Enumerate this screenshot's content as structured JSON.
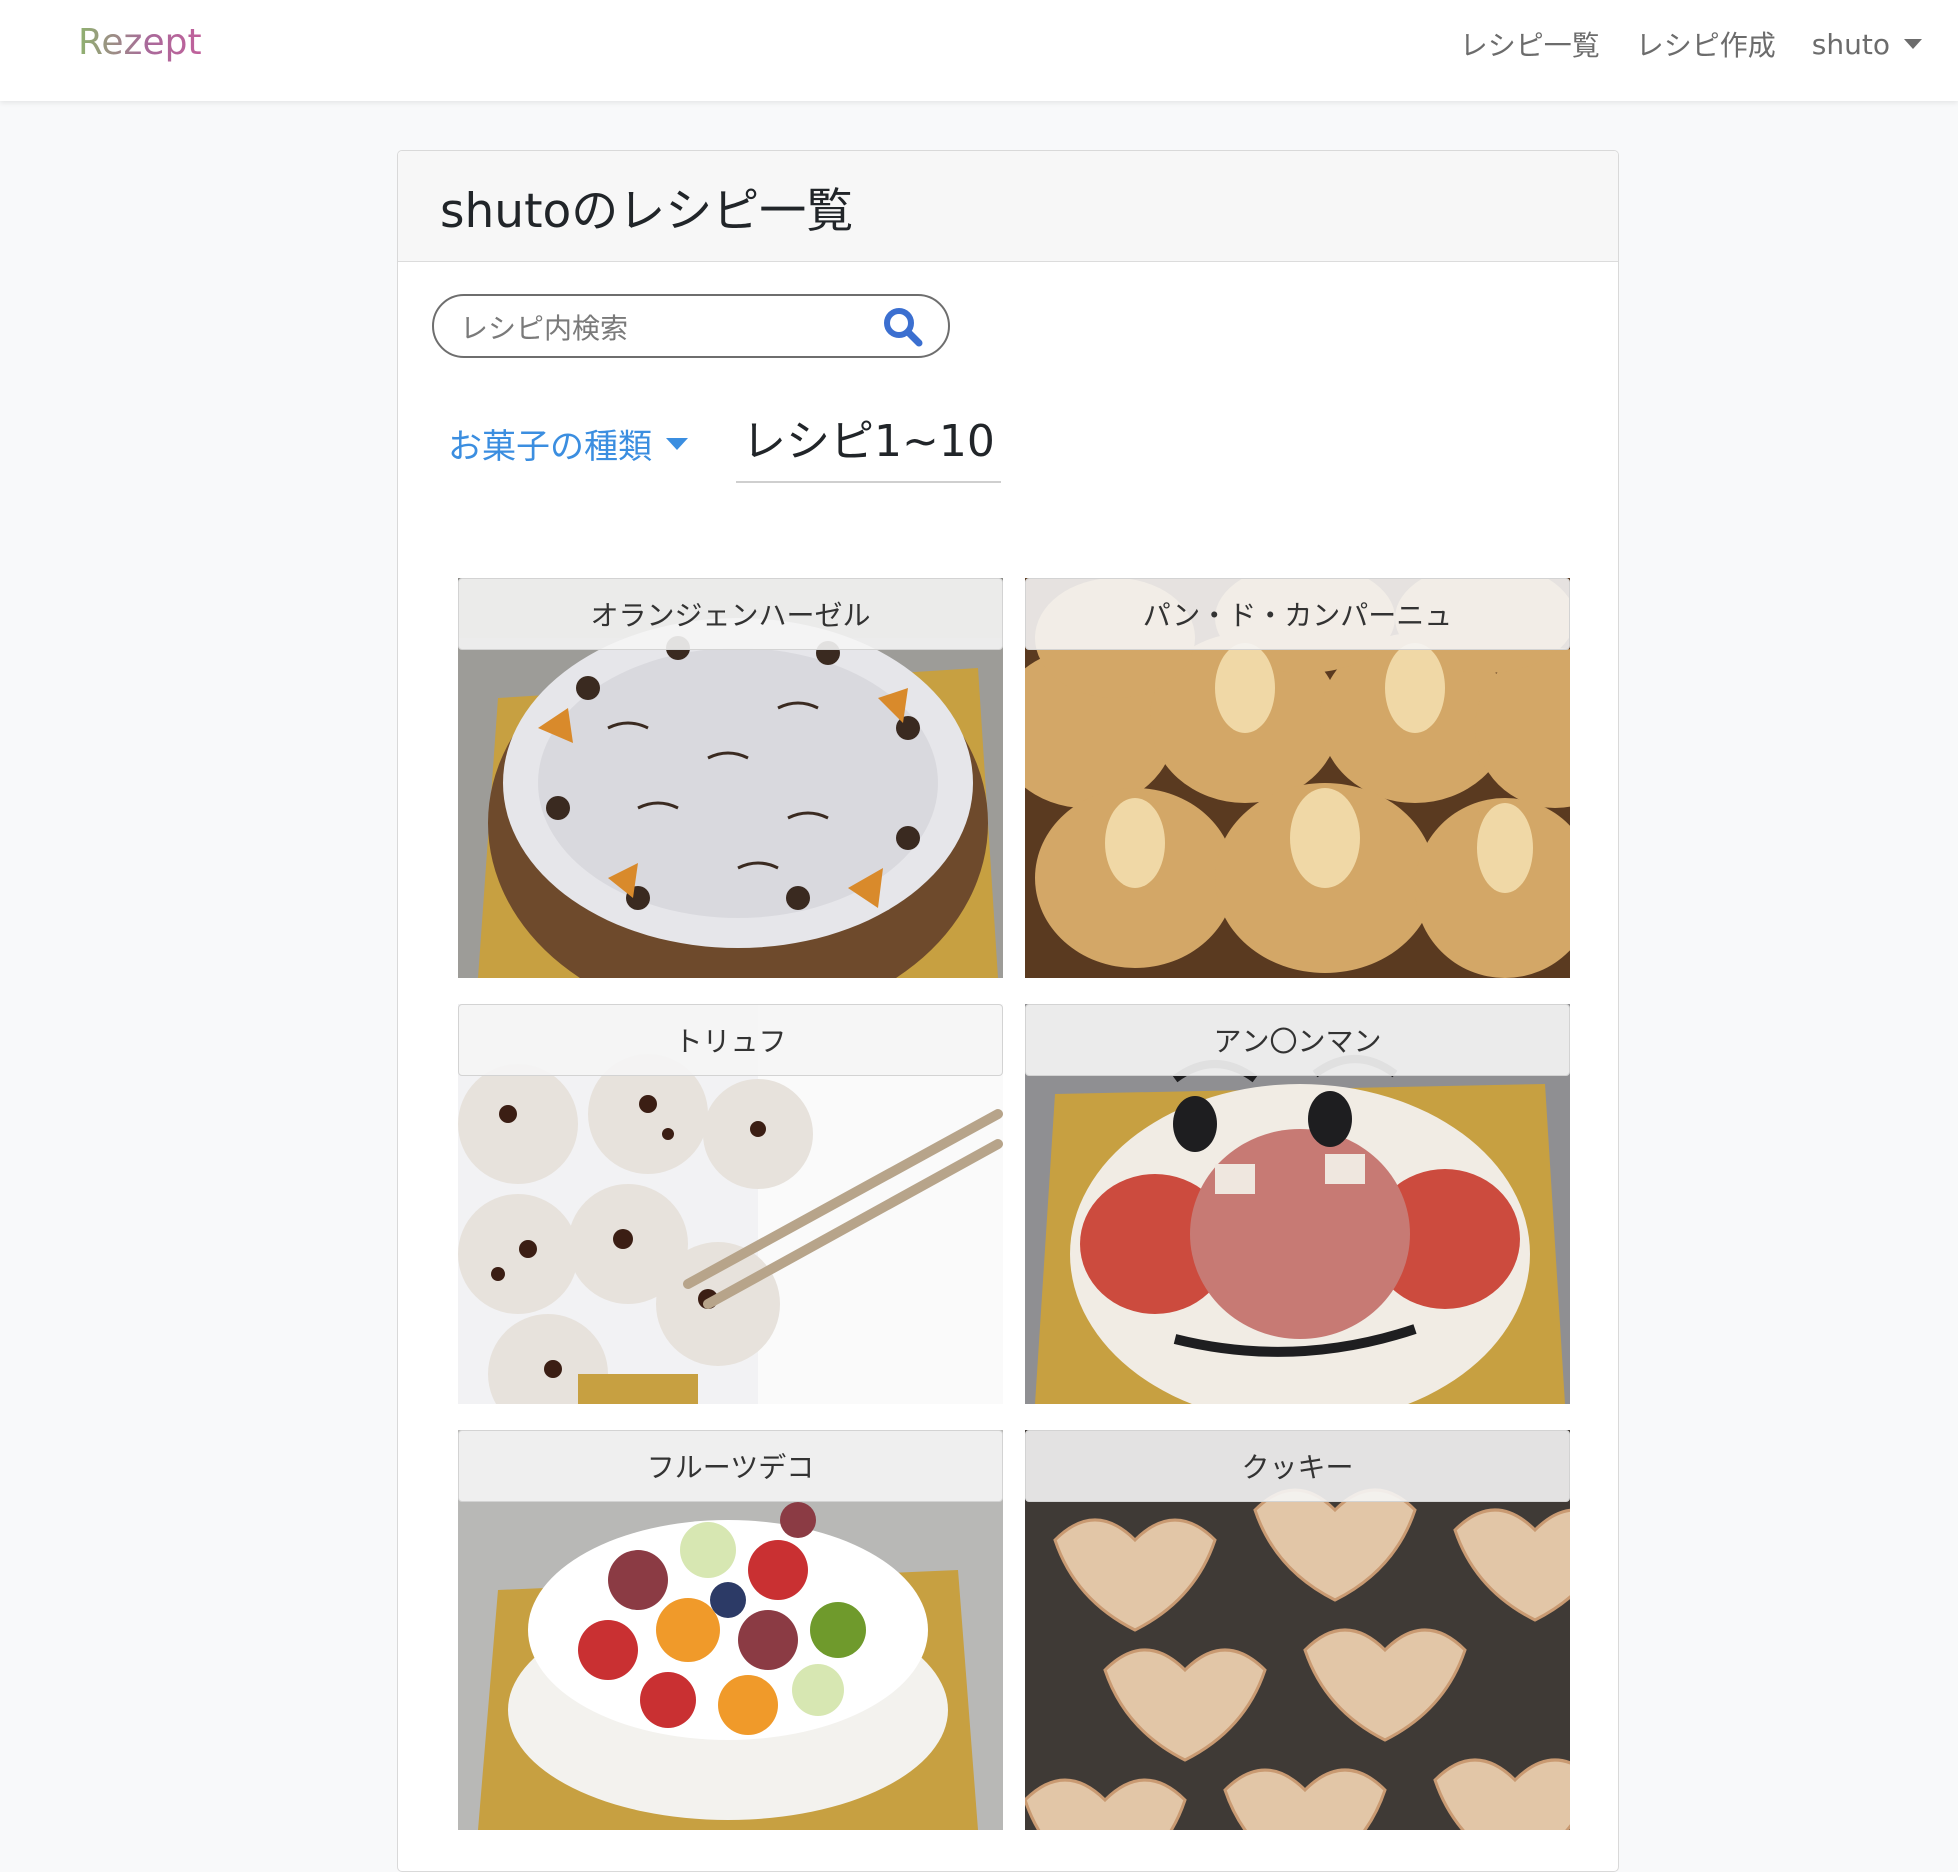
{
  "navbar": {
    "brand": "Rezept",
    "links": [
      {
        "label": "レシピ一覧"
      },
      {
        "label": "レシピ作成"
      }
    ],
    "user": "shuto"
  },
  "page": {
    "title": "shutoのレシピ一覧"
  },
  "search": {
    "placeholder": "レシピ内検索"
  },
  "filter": {
    "category_label": "お菓子の種類",
    "range_label": "レシピ1~10"
  },
  "recipes": [
    {
      "title": "オランジェンハーゼル"
    },
    {
      "title": "パン・ド・カンパーニュ"
    },
    {
      "title": "トリュフ"
    },
    {
      "title": "アン〇ンマン"
    },
    {
      "title": "フルーツデコ"
    },
    {
      "title": "クッキー"
    }
  ],
  "colors": {
    "accent": "#3b8ee0",
    "search_icon": "#3b6fd0"
  }
}
